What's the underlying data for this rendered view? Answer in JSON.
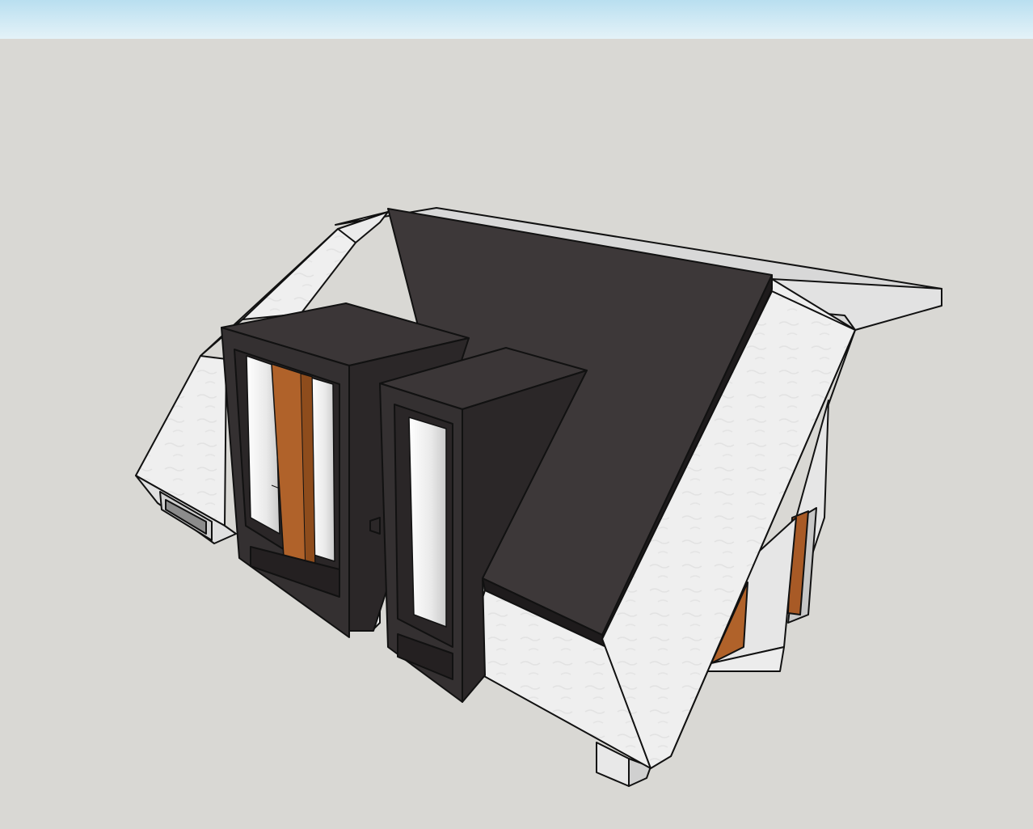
{
  "scene": {
    "sky_top_color": "#b9dff0",
    "sky_bottom_color": "#e6f3f8",
    "ground_color": "#d9d8d4",
    "roof_color": "#3a3536",
    "wall_color": "#f0f0f0",
    "wood_color": "#b0622a",
    "glass_color": "#f7f7f7"
  }
}
